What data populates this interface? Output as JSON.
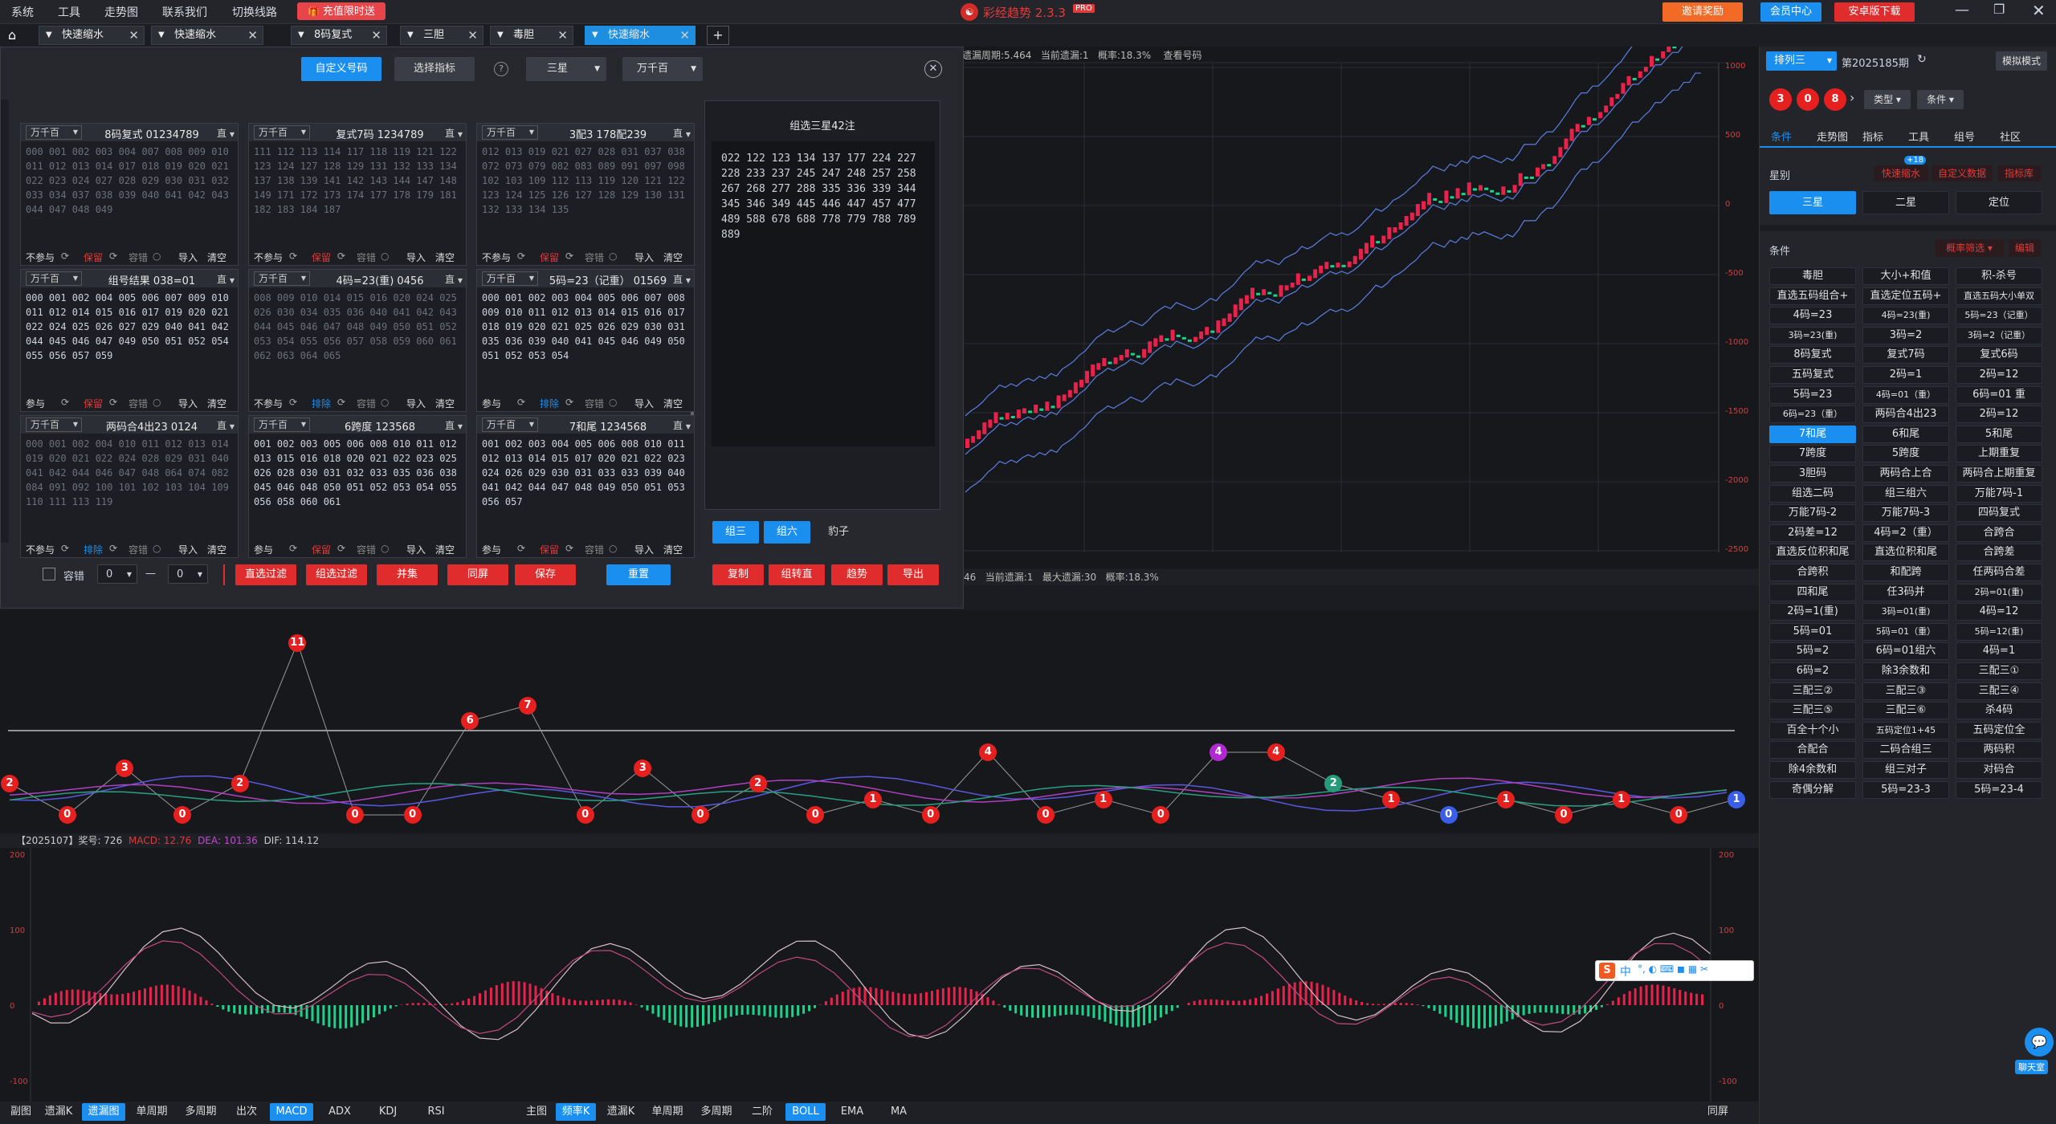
{
  "menu": [
    "系统",
    "工具",
    "走势图",
    "联系我们",
    "切换线路"
  ],
  "promo": "充值限时送",
  "app_title": "彩经趋势 2.3.3",
  "app_badge": "PRO",
  "top_buttons": {
    "reward": "邀请奖励",
    "member": "会员中心",
    "android": "安卓版下载"
  },
  "tabs": [
    {
      "label": "快速缩水",
      "active": false
    },
    {
      "label": "快速缩水",
      "active": false
    },
    {
      "label": "8码复式",
      "active": false
    },
    {
      "label": "三胆",
      "active": false
    },
    {
      "label": "毒胆",
      "active": false
    },
    {
      "label": "快速缩水",
      "active": true
    }
  ],
  "dialog": {
    "tab_custom": "自定义号码",
    "tab_indicator": "选择指标",
    "help": "?",
    "select_star": "三星",
    "select_pos": "万千百",
    "cards": [
      {
        "pos": "万千百",
        "name": "8码复式 01234789",
        "menu": "直",
        "dim": true,
        "text": "000 001 002 003 004 007 008 009 010 011 012 013 014 017 018 019 020 021 022 023 024 027 028 029 030 031 032 033 034 037 038 039 040 041 042 043 044 047 048 049",
        "f1": "不参与",
        "f2": "保留"
      },
      {
        "pos": "万千百",
        "name": "复式7码 1234789",
        "menu": "直",
        "dim": true,
        "text": "111 112 113 114 117 118 119 121 122 123 124 127 128 129 131 132 133 134 137 138 139 141 142 143 144 147 148 149 171 172 173 174 177 178 179 181 182 183 184 187",
        "f1": "不参与",
        "f2": "保留"
      },
      {
        "pos": "万千百",
        "name": "3配3 178配239",
        "menu": "直",
        "dim": true,
        "text": "012 013 019 021 027 028 031 037 038 072 073 079 082 083 089 091 097 098 102 103 109 112 113 119 120 121 122 123 124 125 126 127 128 129 130 131 132 133 134 135",
        "f1": "不参与",
        "f2": "保留"
      },
      {
        "pos": "万千百",
        "name": "组号结果 038=01",
        "menu": "直",
        "dim": false,
        "text": "000 001 002 004 005 006 007 009 010 011 012 014 015 016 017 019 020 021 022 024 025 026 027 029 040 041 042 044 045 046 047 049 050 051 052 054 055 056 057 059",
        "f1": "参与",
        "f2": "保留"
      },
      {
        "pos": "万千百",
        "name": "4码=23(重) 0456",
        "menu": "直",
        "dim": true,
        "text": "008 009 010 014 015 016 020 024 025 026 030 034 035 036 040 041 042 043 044 045 046 047 048 049 050 051 052 053 054 055 056 057 058 059 060 061 062 063 064 065",
        "f1": "不参与",
        "f2": "排除"
      },
      {
        "pos": "万千百",
        "name": "5码=23（记重） 01569",
        "menu": "直",
        "dim": false,
        "text": "000 001 002 003 004 005 006 007 008 009 010 011 012 013 014 015 016 017 018 019 020 021 025 026 029 030 031 035 036 039 040 041 045 046 049 050 051 052 053 054",
        "f1": "参与",
        "f2": "排除"
      },
      {
        "pos": "万千百",
        "name": "两码合4出23 0124",
        "menu": "直",
        "dim": true,
        "text": "000 001 002 004 010 011 012 013 014 019 020 021 022 024 028 029 031 040 041 042 044 046 047 048 064 074 082 084 091 092 100 101 102 103 104 109 110 111 113 119",
        "f1": "不参与",
        "f2": "排除"
      },
      {
        "pos": "万千百",
        "name": "6跨度 123568",
        "menu": "直",
        "dim": false,
        "text": "001 002 003 005 006 008 010 011 012 013 015 016 018 020 021 022 023 025 026 028 030 031 032 033 035 036 038 045 046 048 050 051 052 053 054 055 056 058 060 061",
        "f1": "参与",
        "f2": "保留"
      },
      {
        "pos": "万千百",
        "name": "7和尾 1234568",
        "menu": "直",
        "dim": false,
        "text": "001 002 003 004 005 006 008 010 011 012 013 014 015 017 020 021 022 023 024 026 029 030 031 033 033 039 040 041 042 044 047 048 049 050 051 053 056 057",
        "f1": "参与",
        "f2": "保留"
      }
    ],
    "card_footer": {
      "tol": "容错",
      "import": "导入",
      "clear": "清空"
    },
    "result_title": "组选三星42注",
    "result_text": "022 122 123 134 137 177 224 227 228 233 237 245 247 248 257 258 267 268 277 288 335 336 339 344 345 346 349 445 446 447 457 477 489 588 678 688 778 779 788 789 889",
    "result_btns": [
      "组三",
      "组六",
      "豹子"
    ],
    "tol_label": "容错",
    "tol_from": "0",
    "tol_to": "0",
    "dash": "—",
    "bottom_btns": [
      "直选过滤",
      "组选过滤",
      "并集",
      "同屏",
      "保存"
    ],
    "reset": "重置",
    "result_actions": [
      "复制",
      "组转直",
      "趋势",
      "导出"
    ]
  },
  "chart_top": {
    "info": [
      "遗漏周期:5.464",
      "当前遗漏:1",
      "概率:18.3%",
      "查看号码"
    ],
    "yaxis": [
      "1000",
      "500",
      "0",
      "-500",
      "-1000",
      "-1500",
      "-2000",
      "-2500"
    ]
  },
  "mid_info": [
    "46",
    "当前遗漏:1",
    "最大遗漏:30",
    "概率:18.3%"
  ],
  "balls": [
    {
      "v": "2",
      "c": "r"
    },
    {
      "v": "0",
      "c": "r"
    },
    {
      "v": "3",
      "c": "r"
    },
    {
      "v": "0",
      "c": "r"
    },
    {
      "v": "2",
      "c": "r"
    },
    {
      "v": "11",
      "c": "r"
    },
    {
      "v": "0",
      "c": "r"
    },
    {
      "v": "0",
      "c": "r"
    },
    {
      "v": "6",
      "c": "r"
    },
    {
      "v": "7",
      "c": "r"
    },
    {
      "v": "0",
      "c": "r"
    },
    {
      "v": "3",
      "c": "r"
    },
    {
      "v": "0",
      "c": "r"
    },
    {
      "v": "2",
      "c": "r"
    },
    {
      "v": "0",
      "c": "r"
    },
    {
      "v": "1",
      "c": "r"
    },
    {
      "v": "0",
      "c": "r"
    },
    {
      "v": "4",
      "c": "r"
    },
    {
      "v": "0",
      "c": "r"
    },
    {
      "v": "1",
      "c": "r"
    },
    {
      "v": "0",
      "c": "r"
    },
    {
      "v": "4",
      "c": "p"
    },
    {
      "v": "4",
      "c": "r"
    },
    {
      "v": "2",
      "c": "g"
    },
    {
      "v": "1",
      "c": "r"
    },
    {
      "v": "0",
      "c": "b"
    },
    {
      "v": "1",
      "c": "r"
    },
    {
      "v": "0",
      "c": "r"
    },
    {
      "v": "1",
      "c": "r"
    },
    {
      "v": "0",
      "c": "r"
    },
    {
      "v": "1",
      "c": "b"
    }
  ],
  "macd": {
    "header": "【2025107】奖号: 726",
    "macd": "MACD: 12.76",
    "dea": "DEA: 101.36",
    "dif": "DIF: 114.12",
    "yaxis": [
      "200",
      "100",
      "0",
      "-100"
    ]
  },
  "bottom_left": [
    "副图",
    "遗漏K",
    "遗漏图",
    "单周期",
    "多周期",
    "出次",
    "MACD",
    "ADX",
    "KDJ",
    "RSI"
  ],
  "bottom_right": [
    "主图",
    "频率K",
    "遗漏K",
    "单周期",
    "多周期",
    "二阶",
    "BOLL",
    "EMA",
    "MA"
  ],
  "same_screen": "同屏",
  "side": {
    "sel": "排列三",
    "period": "第2025185期",
    "sim": "模拟模式",
    "draw": [
      "3",
      "0",
      "8"
    ],
    "type": "类型",
    "cond": "条件",
    "nav": [
      "条件",
      "走势图",
      "指标",
      "工具",
      "组号",
      "社区"
    ],
    "star_label": "星别",
    "quick": "快速缩水",
    "quick_badge": "+18",
    "custom": "自定义数据",
    "lib": "指标库",
    "stars": [
      "三星",
      "二星",
      "定位"
    ],
    "cond_label": "条件",
    "prob": "概率筛选",
    "edit": "编辑",
    "conds": [
      "毒胆",
      "大小+和值",
      "积-杀号",
      "直选五码组合+",
      "直选定位五码+",
      "直选五码大小单双",
      "4码=23",
      "4码=23(重)",
      "5码=23（记重）",
      "3码=23(重)",
      "3码=2",
      "3码=2（记重）",
      "8码复式",
      "复式7码",
      "复式6码",
      "五码复式",
      "2码=1",
      "2码=12",
      "5码=23",
      "4码=01（重）",
      "6码=01 重",
      "6码=23（重）",
      "两码合4出23",
      "2码=12",
      "7和尾",
      "6和尾",
      "5和尾",
      "7跨度",
      "5跨度",
      "上期重复",
      "3胆码",
      "两码合上合",
      "两码合上期重复",
      "组选二码",
      "组三组六",
      "万能7码-1",
      "万能7码-2",
      "万能7码-3",
      "四码复式",
      "2码差=12",
      "4码=2（重）",
      "合跨合",
      "直选反位积和尾",
      "直选位积和尾",
      "合跨差",
      "合跨积",
      "和配跨",
      "任两码合差",
      "四和尾",
      "任3码并",
      "2码=01(重)",
      "2码=1(重)",
      "3码=01(重)",
      "4码=12",
      "5码=01",
      "5码=01（重）",
      "5码=12(重)",
      "5码=2",
      "6码=01组六",
      "4码=1",
      "6码=2",
      "除3余数和",
      "三配三①",
      "三配三②",
      "三配三③",
      "三配三④",
      "三配三⑤",
      "三配三⑥",
      "杀4码",
      "百全十个小",
      "五码定位1+45",
      "五码定位全",
      "合配合",
      "二码合组三",
      "两码积",
      "除4余数和",
      "组三对子",
      "对码合",
      "奇偶分解",
      "5码=23-3",
      "5码=23-4"
    ],
    "selected": "7和尾",
    "online": "聊天室"
  },
  "ime": "中"
}
